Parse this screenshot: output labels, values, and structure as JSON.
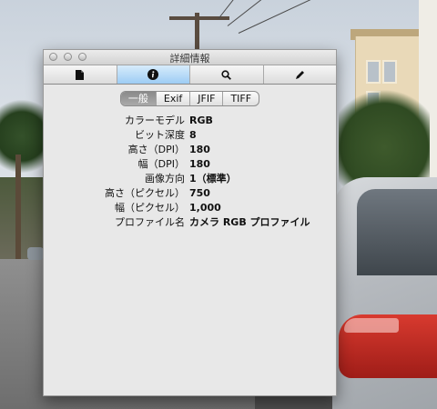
{
  "window": {
    "title": "詳細情報"
  },
  "toolbar": {
    "buttons": [
      {
        "icon": "document-icon",
        "active": false
      },
      {
        "icon": "info-icon",
        "active": true
      },
      {
        "icon": "search-icon",
        "active": false
      },
      {
        "icon": "pen-icon",
        "active": false
      }
    ]
  },
  "tabs": [
    {
      "label": "一般",
      "active": true
    },
    {
      "label": "Exif",
      "active": false
    },
    {
      "label": "JFIF",
      "active": false
    },
    {
      "label": "TIFF",
      "active": false
    }
  ],
  "properties": [
    {
      "label": "カラーモデル",
      "value": "RGB"
    },
    {
      "label": "ビット深度",
      "value": "8"
    },
    {
      "label": "高さ（DPI）",
      "value": "180"
    },
    {
      "label": "幅（DPI）",
      "value": "180"
    },
    {
      "label": "画像方向",
      "value": "1（標準）"
    },
    {
      "label": "高さ（ピクセル）",
      "value": "750"
    },
    {
      "label": "幅（ピクセル）",
      "value": "1,000"
    },
    {
      "label": "プロファイル名",
      "value": "カメラ RGB プロファイル"
    }
  ],
  "colors": {
    "active_tool": "#9dccf4",
    "active_tab": "#8a8a8a",
    "panel": "#e8e8e8"
  }
}
